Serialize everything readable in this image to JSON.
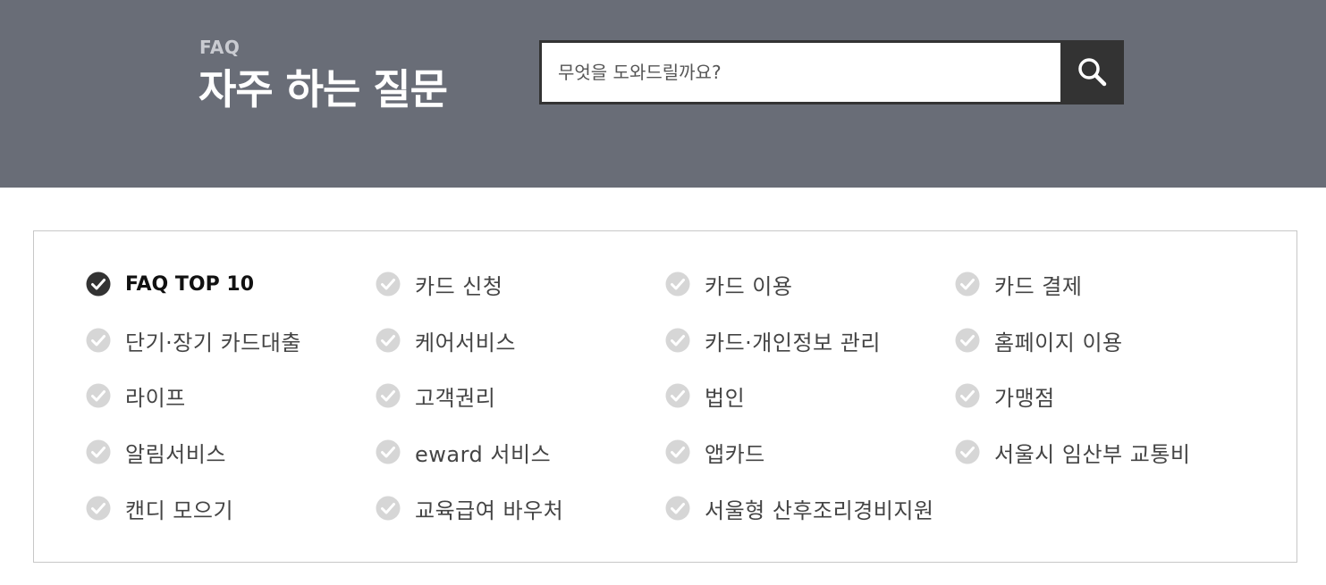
{
  "header": {
    "faq_label": "FAQ",
    "title": "자주 하는 질문",
    "background_color": "#696d77"
  },
  "search": {
    "placeholder": "무엇을 도와드릴까요?",
    "value": "",
    "button_icon": "search-icon"
  },
  "categories": {
    "active_index": 0,
    "check_icon": "check-circle-icon",
    "active_color": "#333333",
    "inactive_color": "#d6d6d6",
    "items": [
      {
        "label": "FAQ TOP 10"
      },
      {
        "label": "카드 신청"
      },
      {
        "label": "카드 이용"
      },
      {
        "label": "카드 결제"
      },
      {
        "label": "단기·장기 카드대출"
      },
      {
        "label": "케어서비스"
      },
      {
        "label": "카드·개인정보 관리"
      },
      {
        "label": "홈페이지 이용"
      },
      {
        "label": "라이프"
      },
      {
        "label": "고객권리"
      },
      {
        "label": "법인"
      },
      {
        "label": "가맹점"
      },
      {
        "label": "알림서비스"
      },
      {
        "label": "eward 서비스"
      },
      {
        "label": "앱카드"
      },
      {
        "label": "서울시 임산부 교통비"
      },
      {
        "label": "캔디 모으기"
      },
      {
        "label": "교육급여 바우처"
      },
      {
        "label": "서울형 산후조리경비지원"
      }
    ]
  }
}
